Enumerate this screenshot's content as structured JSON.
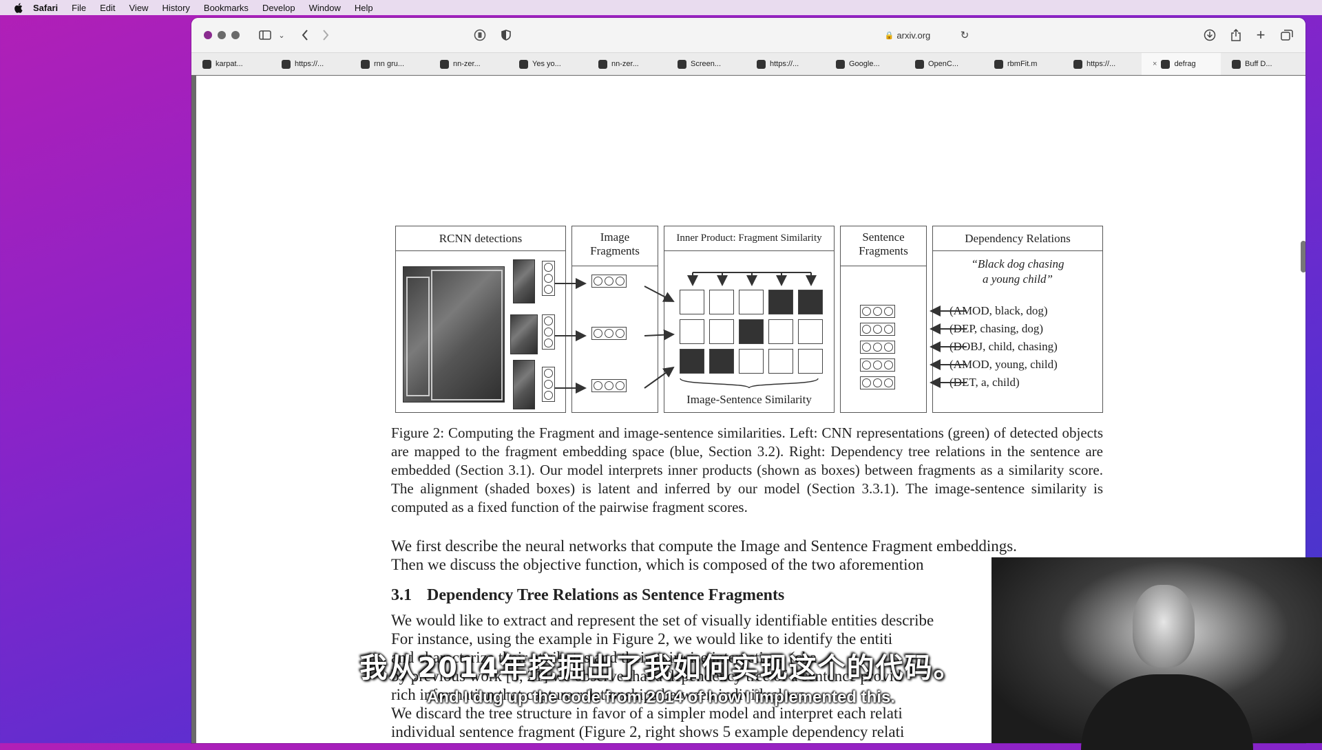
{
  "menubar": {
    "items": [
      "Safari",
      "File",
      "Edit",
      "View",
      "History",
      "Bookmarks",
      "Develop",
      "Window",
      "Help"
    ]
  },
  "toolbar": {
    "url": "arxiv.org",
    "icons": [
      "sidebar-icon",
      "back-icon",
      "forward-icon",
      "privacy-icon",
      "shield-icon",
      "reload-icon",
      "download-icon",
      "share-icon",
      "new-tab-icon",
      "tab-overview-icon"
    ]
  },
  "tabs": [
    {
      "label": "karpat..."
    },
    {
      "label": "https://..."
    },
    {
      "label": "rnn gru..."
    },
    {
      "label": "nn-zer..."
    },
    {
      "label": "Yes yo..."
    },
    {
      "label": "nn-zer..."
    },
    {
      "label": "Screen..."
    },
    {
      "label": "https://..."
    },
    {
      "label": "Google..."
    },
    {
      "label": "OpenC..."
    },
    {
      "label": "rbmFit.m"
    },
    {
      "label": "https://..."
    },
    {
      "label": "defrag",
      "active": true
    },
    {
      "label": "Buff D..."
    }
  ],
  "figure": {
    "panel1": "RCNN detections",
    "panel2": "Image Fragments",
    "panel3": "Inner Product: Fragment Similarity",
    "panel3_bottom": "Image-Sentence Similarity",
    "panel4": "Sentence Fragments",
    "panel5": "Dependency Relations",
    "quote_line1": "“Black dog chasing",
    "quote_line2": "a young child”",
    "relations": [
      "(AMOD, black, dog)",
      "(DEP, chasing, dog)",
      "(DOBJ, child, chasing)",
      "(AMOD, young, child)",
      "(DET, a, child)"
    ],
    "grid": [
      [
        0,
        0,
        0,
        1,
        1
      ],
      [
        0,
        0,
        1,
        0,
        0
      ],
      [
        1,
        1,
        0,
        0,
        0
      ]
    ]
  },
  "caption": {
    "text": "Figure 2: Computing the Fragment and image-sentence similarities. Left: CNN representations (green) of detected objects are mapped to the fragment embedding space (blue, Section 3.2). Right: Dependency tree relations in the sentence are embedded (Section 3.1). Our model interprets inner products (shown as boxes) between fragments as a similarity score. The alignment (shaded boxes) is latent and inferred by our model (Section 3.3.1). The image-sentence similarity is computed as a fixed function of the pairwise fragment scores."
  },
  "body": {
    "para1_line1": "We first describe the neural networks that compute the Image and Sentence Fragment embeddings.",
    "para1_line2": "Then we discuss the objective function, which is composed of the two aforemention",
    "section_num": "3.1",
    "section_title": "Dependency Tree Relations as Sentence Fragments",
    "para2_line1": "We would like to extract and represent the set of visually identifiable entities describe",
    "para2_line2": "For instance, using the example in Figure 2, we would like to identify the entiti",
    "para2_line3": "and characterize their attributes and their pairwise interactions (cha",
    "para2_line4": "by previous work [5, 21] we observe that a dependency tree of a sentence provid",
    "para2_line5": "rich information that capture relationships between individual wo",
    "para2_line6": "We discard the tree structure in favor of a simpler model and interpret each relati",
    "para2_line7": "individual sentence fragment (Figure 2, right shows 5 example dependency relati"
  },
  "subtitles": {
    "zh": "我从2014年挖掘出了我如何实现这个的代码。",
    "en": "And I dug up the code from 2014 of how I implemented this."
  }
}
